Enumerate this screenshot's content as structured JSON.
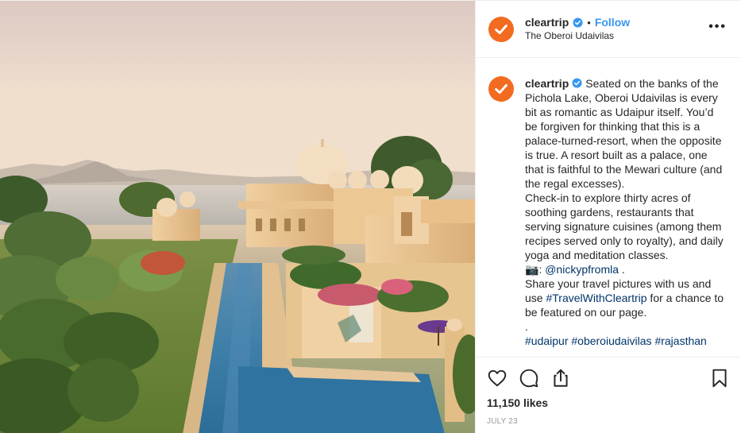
{
  "account": {
    "username": "cleartrip",
    "verified": true,
    "follow_label": "Follow",
    "separator": "•",
    "location": "The Oberoi Udaivilas"
  },
  "header": {
    "more_label": "•••"
  },
  "caption": {
    "username": "cleartrip",
    "paragraph1": "Seated on the banks of the Pichola Lake, Oberoi Udaivilas is every bit as romantic as Udaipur itself. You’d be forgiven for thinking that this is a palace-turned-resort, when the opposite is true. A resort built as a palace, one that is faithful to the Mewari culture (and the regal excesses).",
    "paragraph2": "Check-in to explore thirty acres of soothing gardens, restaurants that serving signature cuisines (among them recipes served only to royalty), and daily yoga and meditation classes.",
    "camera_emoji": "📷",
    "credit_handle": "@nickypfromla",
    "credit_suffix": " .",
    "share_prefix": "Share your travel pictures with us and use ",
    "share_hashtag": "#TravelWithCleartrip",
    "share_suffix": " for a chance to be featured on our page.",
    "dot_line": ".",
    "hashtags": "#udaipur #oberoiudaivilas #rajasthan"
  },
  "icons": {
    "like": "heart-icon",
    "comment": "comment-icon",
    "share": "share-icon",
    "save": "bookmark-icon"
  },
  "stats": {
    "likes": "11,150 likes",
    "date": "JULY 23"
  },
  "colors": {
    "brand": "#f26b21",
    "link_blue": "#3897f0",
    "hashtag": "#003569",
    "verified": "#3897f0"
  },
  "photo": {
    "alt": "The Oberoi Udaivilas palace resort beside Lake Pichola with a long reflecting pool and gardens"
  }
}
